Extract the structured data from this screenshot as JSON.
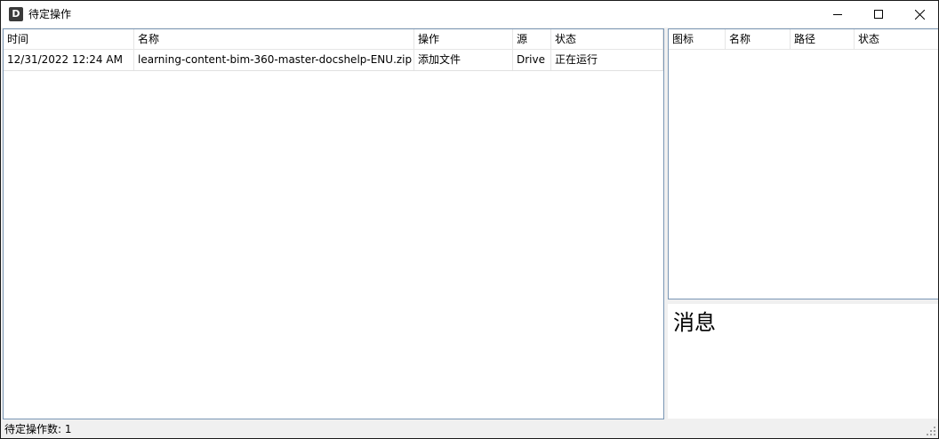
{
  "window": {
    "title": "待定操作",
    "app_icon_letter": "D"
  },
  "operations_table": {
    "columns": [
      "时间",
      "名称",
      "操作",
      "源",
      "状态"
    ],
    "rows": [
      {
        "time": "12/31/2022 12:24 AM",
        "name": "learning-content-bim-360-master-docshelp-ENU.zip",
        "operation": "添加文件",
        "source": "Drive",
        "status": "正在运行"
      }
    ]
  },
  "details_table": {
    "columns": [
      "图标",
      "名称",
      "路径",
      "状态"
    ]
  },
  "messages": {
    "title": "消息"
  },
  "statusbar": {
    "text": "待定操作数: 1"
  },
  "colors": {
    "panel_border": "#7a96b4",
    "window_border": "#1a1a1a",
    "background": "#f0f0f0"
  }
}
